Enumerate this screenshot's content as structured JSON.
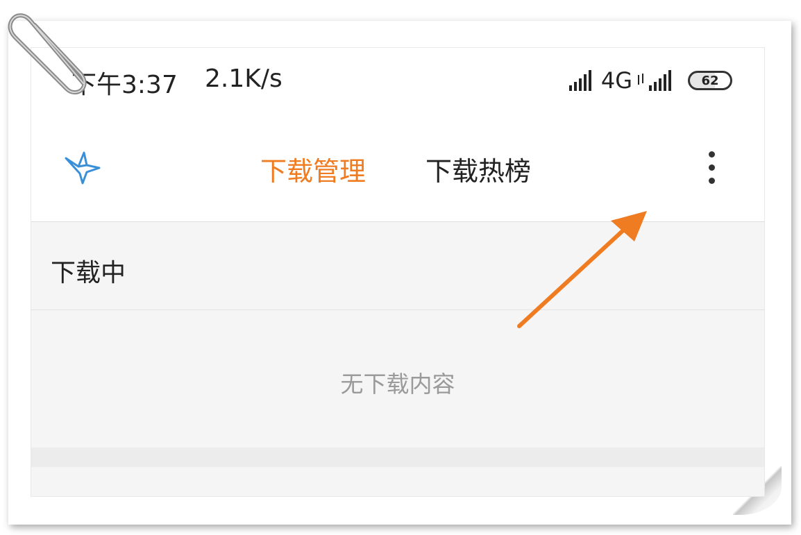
{
  "status_bar": {
    "time": "下午3:37",
    "net_speed": "2.1K/s",
    "network_type": "4G",
    "battery_level": "62",
    "signal_icon": "signal-bars-icon"
  },
  "header": {
    "logo_icon": "bird-logo-icon",
    "tabs": [
      {
        "label": "下载管理",
        "active": true
      },
      {
        "label": "下载热榜",
        "active": false
      }
    ],
    "more_icon": "more-vertical-icon"
  },
  "section": {
    "title": "下载中"
  },
  "empty_state": {
    "message": "无下载内容"
  },
  "colors": {
    "accent": "#f07c22",
    "logo_blue": "#3a8fd9",
    "arrow": "#f07c22"
  },
  "decorations": {
    "paperclip_icon": "paperclip-icon",
    "annotation_arrow": "arrow-pointer-icon"
  }
}
